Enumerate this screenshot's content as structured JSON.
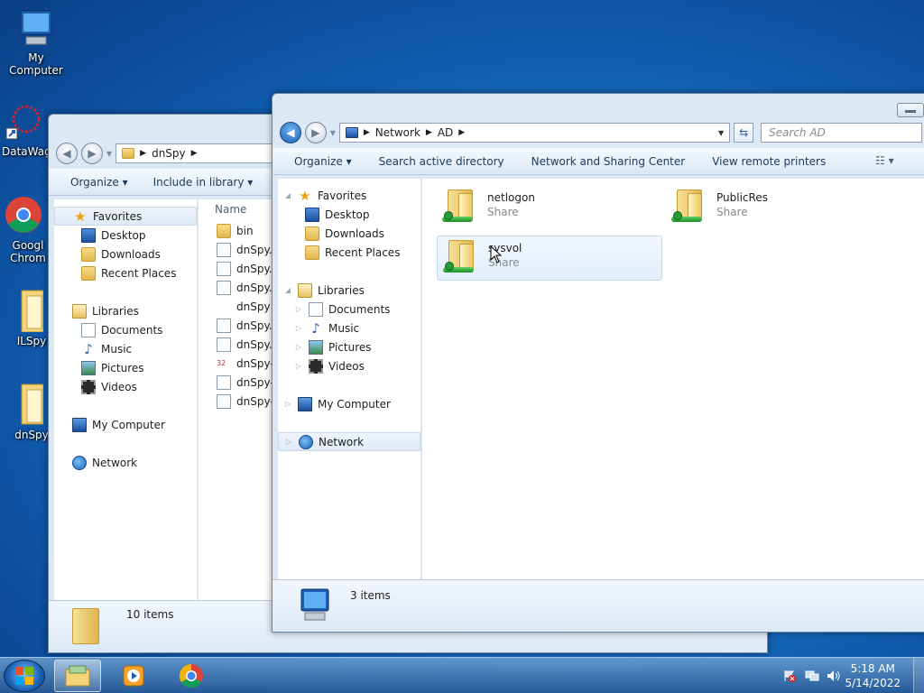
{
  "desktop": {
    "icons": [
      {
        "label": "My Computer"
      },
      {
        "label": "DataWag"
      },
      {
        "label": "Googl Chrom"
      },
      {
        "label": "ILSpy"
      },
      {
        "label": "dnSpy"
      }
    ]
  },
  "back_window": {
    "path": [
      "dnSpy"
    ],
    "commands": [
      "Organize",
      "Include in library"
    ],
    "nav": {
      "favorites": "Favorites",
      "favorite_items": [
        "Desktop",
        "Downloads",
        "Recent Places"
      ],
      "libraries": "Libraries",
      "library_items": [
        "Documents",
        "Music",
        "Pictures",
        "Videos"
      ],
      "computer": "My Computer",
      "network": "Network"
    },
    "column_header": "Name",
    "files": [
      "bin",
      "dnSpy.C",
      "dnSpy.C",
      "dnSpy.C",
      "dnSpy",
      "dnSpy.e",
      "dnSpy.p",
      "dnSpy-x",
      "dnSpy-x",
      "dnSpy-x"
    ],
    "status": "10 items"
  },
  "front_window": {
    "path": [
      "Network",
      "AD"
    ],
    "search_placeholder": "Search AD",
    "commands": [
      "Organize",
      "Search active directory",
      "Network and Sharing Center",
      "View remote printers"
    ],
    "nav": {
      "favorites": "Favorites",
      "favorite_items": [
        "Desktop",
        "Downloads",
        "Recent Places"
      ],
      "libraries": "Libraries",
      "library_items": [
        "Documents",
        "Music",
        "Pictures",
        "Videos"
      ],
      "computer": "My Computer",
      "network": "Network"
    },
    "shares": [
      {
        "name": "netlogon",
        "type": "Share"
      },
      {
        "name": "PublicRes",
        "type": "Share"
      },
      {
        "name": "sysvol",
        "type": "Share"
      }
    ],
    "status": "3 items"
  },
  "taskbar": {
    "time": "5:18 AM",
    "date": "5/14/2022"
  },
  "colors": {
    "accent": "#1f7fcf",
    "selection": "#e2eefb"
  }
}
